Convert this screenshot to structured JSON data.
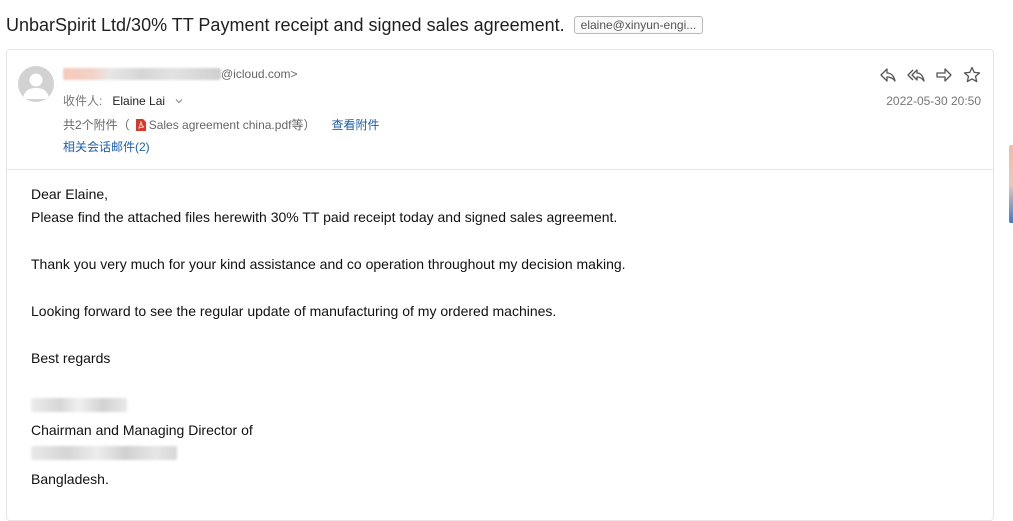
{
  "subject": "UnbarSpirit Ltd/30% TT Payment receipt and signed sales agreement.",
  "subject_tag": "elaine@xinyun-engi...",
  "sender": {
    "email_suffix": "@icloud.com>"
  },
  "recipient": {
    "label": "收件人:",
    "name": "Elaine Lai"
  },
  "attachments": {
    "count_prefix": "共2个附件（",
    "file": "Sales agreement china.pdf等）",
    "view_link": "查看附件"
  },
  "related_link": "相关会话邮件(2)",
  "date": "2022-05-30 20:50",
  "actions": [
    "reply-icon",
    "reply-all-icon",
    "forward-icon",
    "star-icon"
  ],
  "body": {
    "greeting": "Dear Elaine,",
    "line1": "Please find the attached files herewith 30% TT paid receipt today and signed sales agreement.",
    "line2": "Thank you very much for your kind assistance and co operation throughout my decision making.",
    "line3": "Looking forward to see the regular update of manufacturing of my ordered machines.",
    "closing": "Best regards",
    "title": "Chairman and Managing Director of",
    "country": "Bangladesh."
  },
  "colors": {
    "link": "#1d5fa8",
    "muted": "#777777"
  }
}
